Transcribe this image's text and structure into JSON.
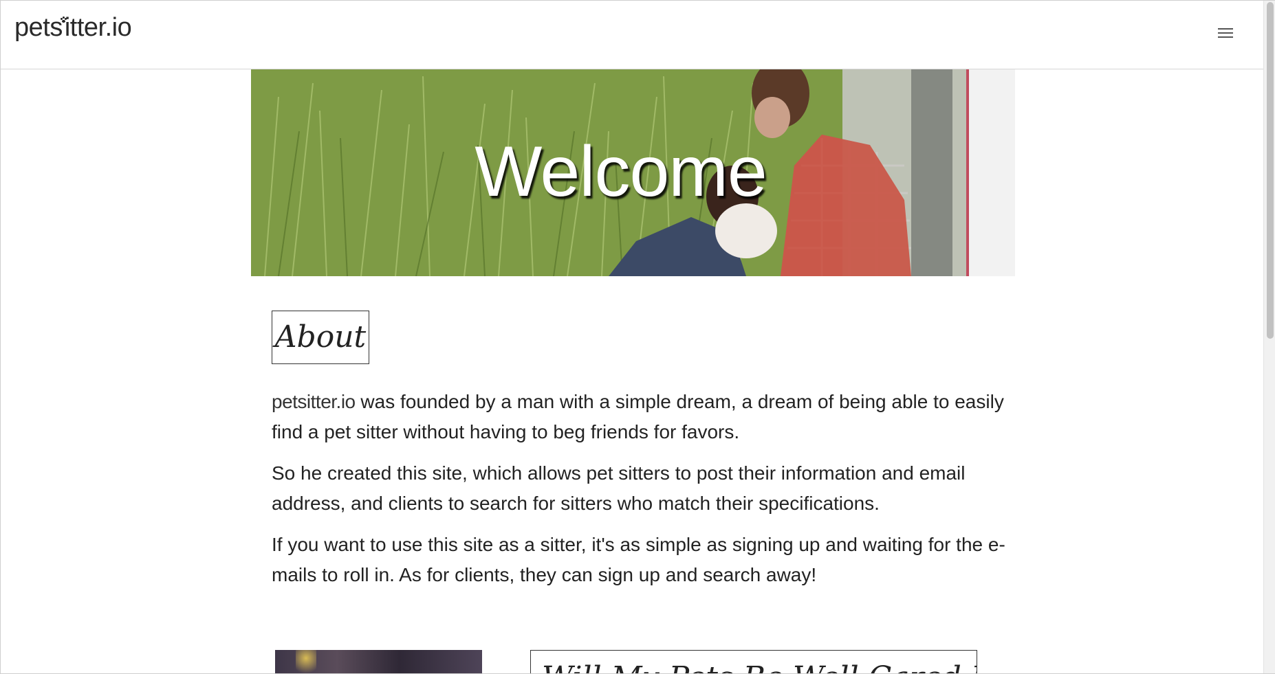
{
  "navbar": {
    "logo_pre": "pets",
    "logo_i": "i",
    "logo_post": "tter.io",
    "menu_icon": "hamburger-menu-icon"
  },
  "hero": {
    "title": "Welcome",
    "image": "man-with-dog-in-grass-photo"
  },
  "about": {
    "title": "About",
    "inline_logo": "petsitter.io",
    "paragraph_1_rest": " was founded by a man with a simple dream, a dream of being able to easily find a pet sitter without having to beg friends for favors.",
    "paragraph_2": "So he created this site, which allows pet sitters to post their information and email address, and clients to search for sitters who match their specifications.",
    "paragraph_3": "If you want to use this site as a sitter, it's as simple as signing up and waiting for the e-mails to roll in. As for clients, they can sign up and search away!"
  },
  "section2": {
    "card_title": "Will My Pets Be Well Cared For?",
    "image": "pet-photo-thumbnail"
  },
  "colors": {
    "text": "#222222",
    "border": "#333333",
    "hero_text": "#ffffff"
  }
}
